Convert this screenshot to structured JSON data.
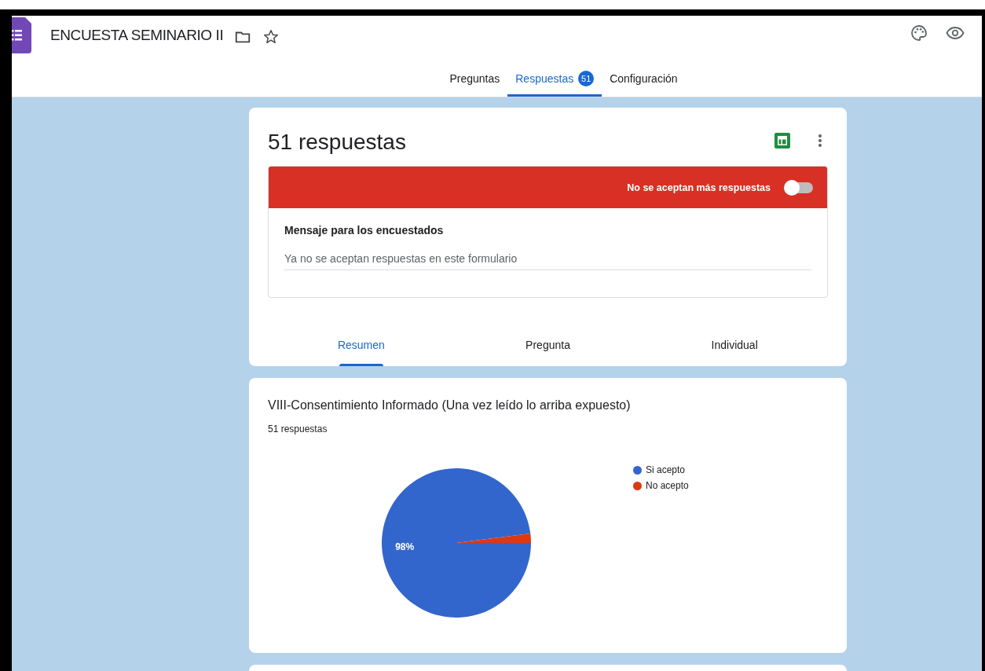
{
  "window": {
    "title": "ENCUESTA SEMINARIO II"
  },
  "tabs": [
    {
      "label": "Preguntas",
      "selected": false
    },
    {
      "label": "Respuestas",
      "selected": true,
      "badge": "51"
    },
    {
      "label": "Configuración",
      "selected": false
    }
  ],
  "summary": {
    "title": "51 respuestas",
    "accepting": {
      "label": "No se aceptan más respuestas",
      "on": false
    },
    "message": {
      "label": "Mensaje para los encuestados",
      "value": "Ya no se aceptan respuestas en este formulario"
    },
    "views": [
      {
        "label": "Resumen",
        "selected": true
      },
      {
        "label": "Pregunta",
        "selected": false
      },
      {
        "label": "Individual",
        "selected": false
      }
    ]
  },
  "questions": [
    {
      "title": "VIII-Consentimiento Informado (Una vez leído lo arriba expuesto)",
      "count": "51 respuestas",
      "chart_data": {
        "type": "pie",
        "categories": [
          "Si acepto",
          "No acepto"
        ],
        "values": [
          98,
          2
        ],
        "colors": [
          "#3366cc",
          "#dc3912"
        ],
        "value_labels": [
          "98%",
          null
        ]
      }
    }
  ]
}
